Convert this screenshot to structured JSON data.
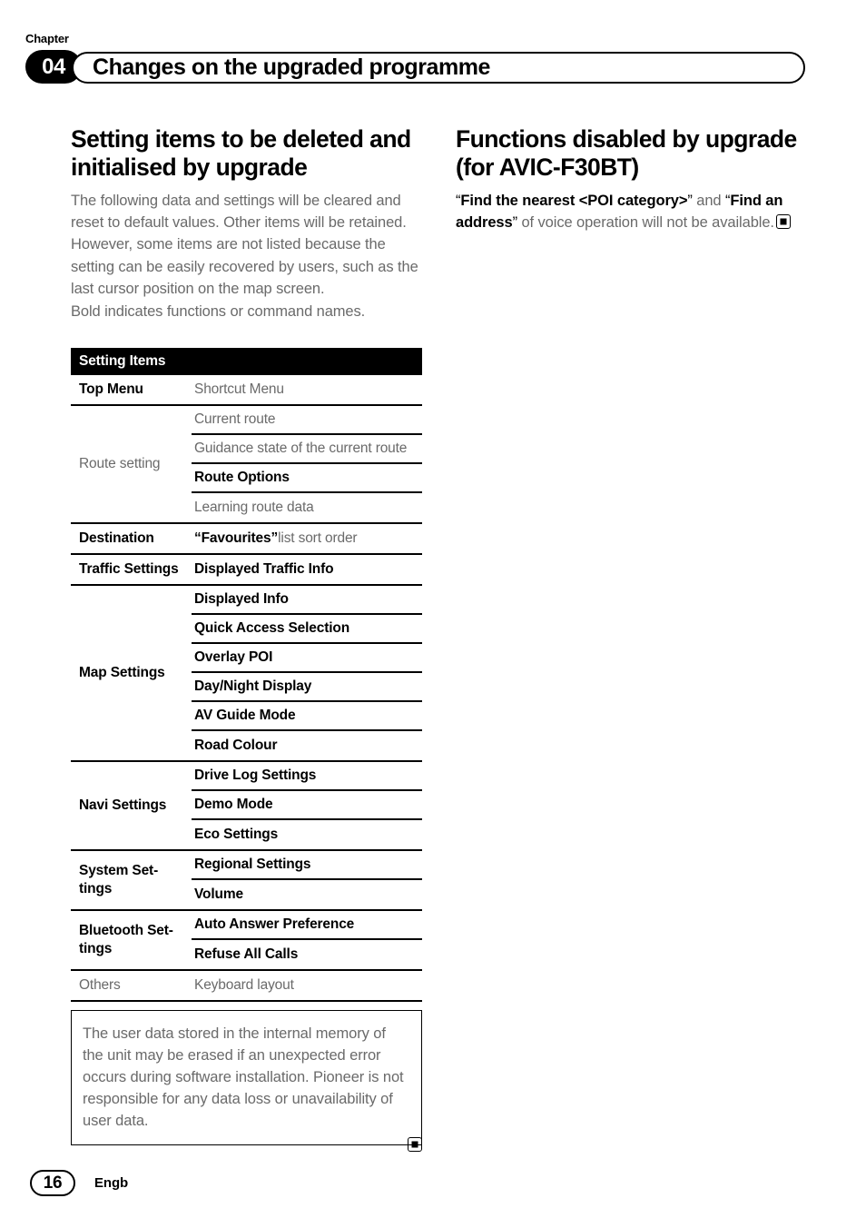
{
  "header": {
    "chapter_label": "Chapter",
    "chapter_number": "04",
    "chapter_title": "Changes on the upgraded programme"
  },
  "left_column": {
    "heading": "Setting items to be deleted and initialised by upgrade",
    "paragraph_1": "The following data and settings will be cleared and reset to default values. Other items will be retained. However, some items are not listed because the setting can be easily recovered by users, such as the last cursor position on the map screen.",
    "paragraph_2": "Bold indicates functions or command names."
  },
  "right_column": {
    "heading": "Functions disabled by upgrade (for AVIC-F30BT)",
    "paragraph_parts": {
      "quote_open_1": "“",
      "bold_1": "Find the nearest <POI category>",
      "quote_close_1": "”",
      "mid": " and ",
      "quote_open_2": "“",
      "bold_2": "Find an address",
      "quote_close_2": "”",
      "tail": " of voice operation will not be available."
    }
  },
  "table": {
    "header": "Setting Items",
    "groups": [
      {
        "category": "Top Menu",
        "category_style": "bold",
        "items": [
          {
            "text": "Shortcut Menu",
            "style": "plain"
          }
        ]
      },
      {
        "category": "Route setting",
        "category_style": "plain",
        "items": [
          {
            "text": "Current route",
            "style": "plain"
          },
          {
            "text": "Guidance state of the current route",
            "style": "plain"
          },
          {
            "text": "Route Options",
            "style": "bold"
          },
          {
            "text": "Learning route data",
            "style": "plain"
          }
        ]
      },
      {
        "category": "Destination",
        "category_style": "bold",
        "items": [
          {
            "style": "mixed",
            "parts": [
              {
                "text": "“",
                "weight": "bold"
              },
              {
                "text": "Favourites",
                "weight": "bold"
              },
              {
                "text": "”",
                "weight": "bold"
              },
              {
                "text": " list sort order",
                "weight": "regular"
              }
            ]
          }
        ]
      },
      {
        "category": "Traffic Settings",
        "category_style": "bold",
        "items": [
          {
            "text": "Displayed Traffic Info",
            "style": "bold"
          }
        ]
      },
      {
        "category": "Map Settings",
        "category_style": "bold",
        "items": [
          {
            "text": "Displayed Info",
            "style": "bold"
          },
          {
            "text": "Quick Access Selection",
            "style": "bold"
          },
          {
            "text": "Overlay POI",
            "style": "bold"
          },
          {
            "text": "Day/Night Display",
            "style": "bold"
          },
          {
            "text": "AV Guide Mode",
            "style": "bold"
          },
          {
            "text": "Road Colour",
            "style": "bold"
          }
        ]
      },
      {
        "category": "Navi Settings",
        "category_style": "bold",
        "items": [
          {
            "text": "Drive Log Settings",
            "style": "bold"
          },
          {
            "text": "Demo Mode",
            "style": "bold"
          },
          {
            "text": "Eco Settings",
            "style": "bold"
          }
        ]
      },
      {
        "category": "System Set-\ntings",
        "category_style": "bold",
        "items": [
          {
            "text": "Regional Settings",
            "style": "bold"
          },
          {
            "text": "Volume",
            "style": "bold"
          }
        ]
      },
      {
        "category": "Bluetooth Set-\ntings",
        "category_style": "bold",
        "items": [
          {
            "text": "Auto Answer Preference",
            "style": "bold"
          },
          {
            "text": "Refuse All Calls",
            "style": "bold"
          }
        ]
      },
      {
        "category": "Others",
        "category_style": "plain",
        "items": [
          {
            "text": "Keyboard layout",
            "style": "plain"
          }
        ]
      }
    ]
  },
  "note_box": {
    "text": "The user data stored in the internal memory of the unit may be erased if an unexpected error occurs during software installation. Pioneer is not responsible for any data loss or unavailability of user data."
  },
  "footer": {
    "page_number": "16",
    "language": "Engb"
  },
  "colors": {
    "text_primary": "#000000",
    "text_secondary": "#6a6a6a",
    "table_header_bg": "#000000",
    "page_bg": "#ffffff"
  }
}
